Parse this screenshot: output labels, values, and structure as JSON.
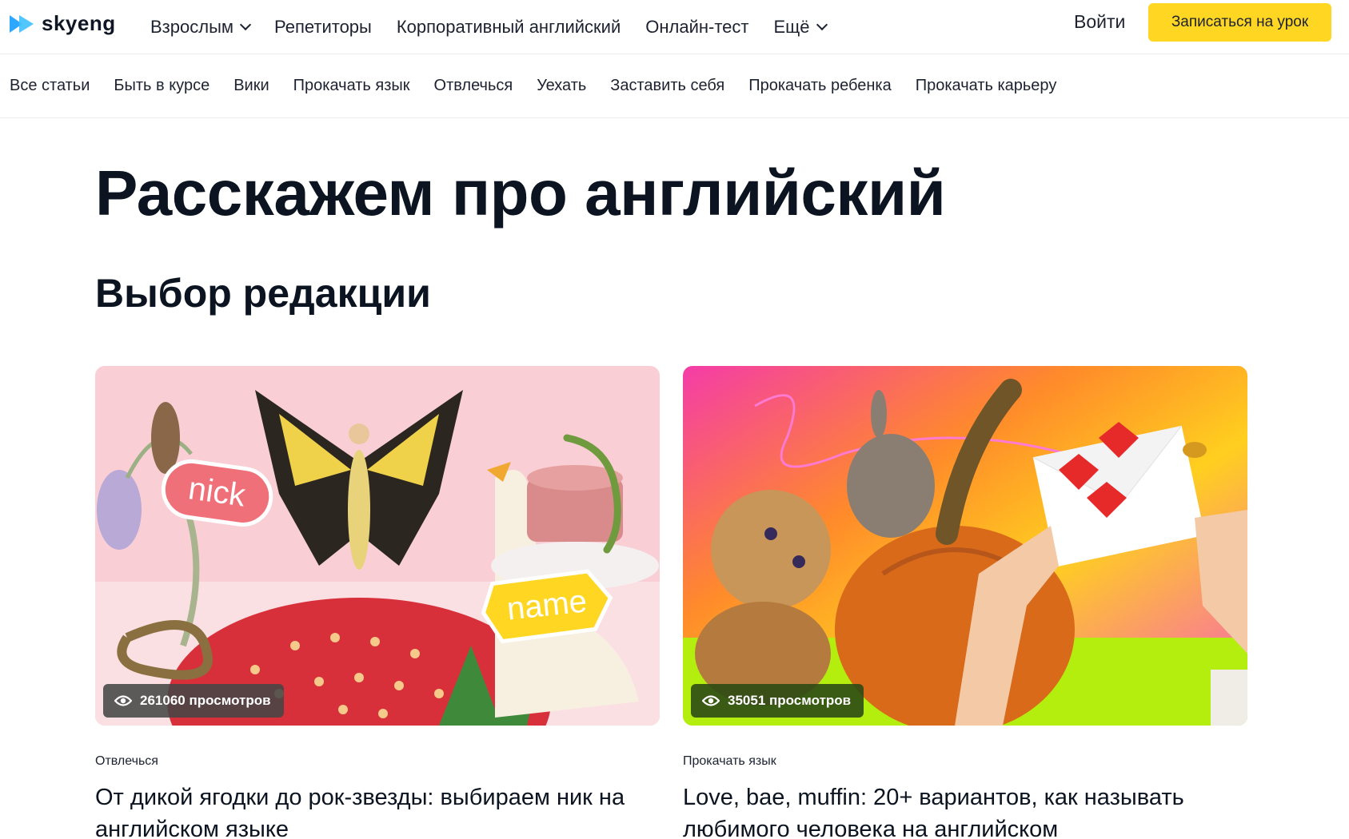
{
  "logo": {
    "text": "skyeng"
  },
  "nav": {
    "items": [
      {
        "label": "Взрослым",
        "dropdown": true
      },
      {
        "label": "Репетиторы",
        "dropdown": false
      },
      {
        "label": "Корпоративный английский",
        "dropdown": false
      },
      {
        "label": "Онлайн-тест",
        "dropdown": false
      },
      {
        "label": "Ещё",
        "dropdown": true
      }
    ],
    "login": "Войти",
    "cta": "Записаться на урок"
  },
  "subnav": {
    "items": [
      "Все статьи",
      "Быть в курсе",
      "Вики",
      "Прокачать язык",
      "Отвлечься",
      "Уехать",
      "Заставить себя",
      "Прокачать ребенка",
      "Прокачать карьеру"
    ]
  },
  "hero": {
    "title": "Расскажем про английский"
  },
  "section": {
    "title": "Выбор редакции"
  },
  "cards": [
    {
      "views": "261060 просмотров",
      "category": "Отвлечься",
      "title": "От дикой ягодки до рок-звезды: выбираем ник на английском языке",
      "tags": [
        "nick",
        "name"
      ]
    },
    {
      "views": "35051 просмотров",
      "category": "Прокачать язык",
      "title": "Love, bae, muffin: 20+ вариантов, как называть любимого человека на английском"
    }
  ],
  "colors": {
    "accent": "#ffd722",
    "logo_blue": "#2da7ff",
    "text": "#0b1420"
  }
}
